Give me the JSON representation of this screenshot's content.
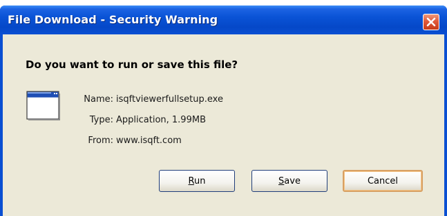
{
  "window": {
    "title": "File Download - Security Warning",
    "close_icon": "close-icon"
  },
  "dialog": {
    "question": "Do you want to run or save this file?",
    "icon": "application-window-icon",
    "details": {
      "name_label": "Name:",
      "name_value": "isqftviewerfullsetup.exe",
      "type_label": "Type:",
      "type_value": "Application, 1.99MB",
      "from_label": "From:",
      "from_value": "www.isqft.com"
    }
  },
  "buttons": {
    "run_first": "R",
    "run_rest": "un",
    "save_first": "S",
    "save_rest": "ave",
    "cancel_label": "Cancel"
  },
  "colors": {
    "title_bar": "#0a4fd2",
    "client_bg": "#ece9d8",
    "close_button": "#e0593a",
    "default_button_border": "#d8a063"
  }
}
